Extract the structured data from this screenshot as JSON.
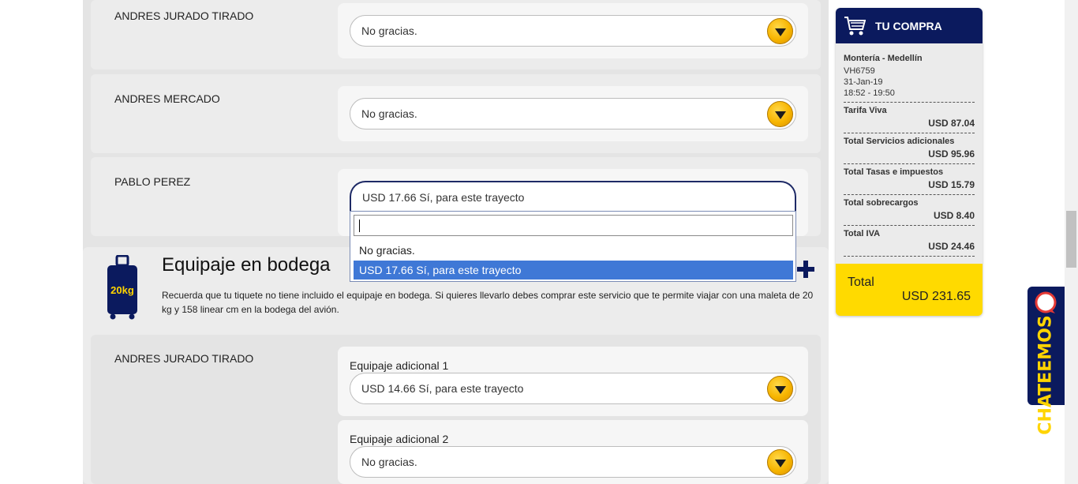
{
  "passengers_top": [
    {
      "name": "ANDRES JURADO TIRADO",
      "selection": "No gracias."
    },
    {
      "name": "ANDRES MERCADO",
      "selection": "No gracias."
    },
    {
      "name": "PABLO PEREZ",
      "selection": "USD 17.66 Sí, para este trayecto"
    }
  ],
  "dropdown": {
    "search_value": "",
    "options": [
      "No gracias.",
      "USD 17.66 Sí, para este trayecto"
    ],
    "selected_index": 1
  },
  "section": {
    "title": "Equipaje en bodega",
    "icon": "luggage-icon",
    "icon_label": "20kg",
    "description": "Recuerda que tu tiquete no tiene incluido el equipaje en bodega. Si quieres llevarlo debes comprar este servicio que te permite viajar con una maleta de 20 kg y 158 linear cm en la bodega del avión.",
    "passenger": {
      "name": "ANDRES JURADO TIRADO",
      "fields": [
        {
          "label": "Equipaje adicional 1",
          "selection": "USD 14.66 Sí, para este trayecto"
        },
        {
          "label": "Equipaje adicional 2",
          "selection": "No gracias."
        }
      ]
    }
  },
  "cart": {
    "title": "TU COMPRA",
    "route": "Montería - Medellín",
    "flight": "VH6759",
    "date": "31-Jan-19",
    "time": "18:52 - 19:50",
    "items": [
      {
        "label": "Tarifa Viva",
        "value": "USD 87.04"
      },
      {
        "label": "Total Servicios adicionales",
        "value": "USD 95.96"
      },
      {
        "label": "Total Tasas e impuestos",
        "value": "USD 15.79"
      },
      {
        "label": "Total sobrecargos",
        "value": "USD 8.40"
      },
      {
        "label": "Total IVA",
        "value": "USD 24.46"
      }
    ],
    "total_label": "Total",
    "total_value": "USD 231.65"
  },
  "chat": {
    "label": "CHATEEMOS"
  },
  "colors": {
    "navy": "#0b1a5e",
    "yellow": "#ffda00",
    "highlight": "#3f78d6"
  }
}
